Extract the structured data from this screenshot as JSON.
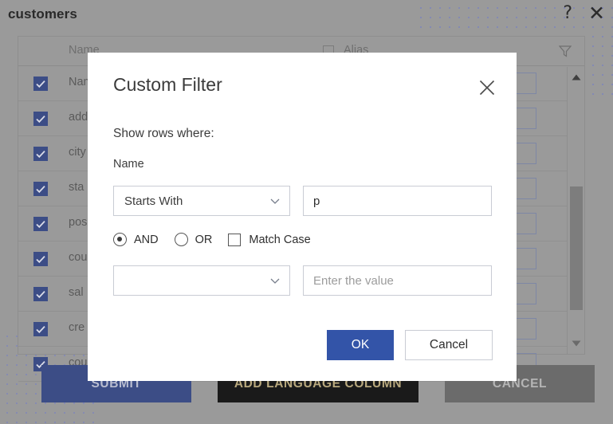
{
  "window": {
    "title": "customers",
    "help_icon": "question-mark-icon",
    "close_icon": "close-icon"
  },
  "background_panel": {
    "columns": {
      "name_header": "Name",
      "alias_header": "Alias"
    },
    "filter_icon": "funnel-filter-icon",
    "rows": [
      {
        "label": "Name",
        "checked": true
      },
      {
        "label": "add",
        "checked": true
      },
      {
        "label": "city",
        "checked": true
      },
      {
        "label": "sta",
        "checked": true
      },
      {
        "label": "pos",
        "checked": true
      },
      {
        "label": "cou",
        "checked": true
      },
      {
        "label": "sal",
        "checked": true
      },
      {
        "label": "cre",
        "checked": true
      },
      {
        "label": "cou",
        "checked": true
      }
    ],
    "scrollbar": {
      "up_icon": "scroll-up-arrow-icon",
      "down_icon": "scroll-down-arrow-icon"
    },
    "actions": {
      "submit": "SUBMIT",
      "add_language_column": "ADD LANGUAGE COLUMN",
      "cancel": "CANCEL"
    }
  },
  "dialog": {
    "title": "Custom Filter",
    "close_icon": "close-icon",
    "subtitle": "Show rows where:",
    "field_label": "Name",
    "condition_1": {
      "operator_value": "Starts With",
      "operator_chevron": "chevron-down-icon",
      "value": "p",
      "value_placeholder": ""
    },
    "logic": {
      "and_label": "AND",
      "or_label": "OR",
      "selected": "AND",
      "match_case_label": "Match Case",
      "match_case_checked": false
    },
    "condition_2": {
      "operator_value": "",
      "operator_chevron": "chevron-down-icon",
      "value": "",
      "value_placeholder": "Enter the value"
    },
    "buttons": {
      "ok": "OK",
      "cancel": "Cancel"
    }
  },
  "colors": {
    "accent_blue": "#3354a8",
    "checkbox_blue": "#3c4d86",
    "backdrop_gray": "#9a9a9a",
    "dot_pattern": "#7f86b8"
  }
}
